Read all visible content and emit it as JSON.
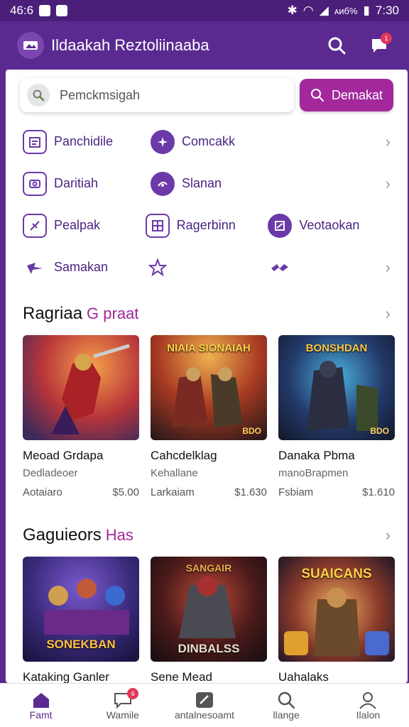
{
  "status": {
    "time_left": "46:6",
    "time_right": "7:30",
    "signal_text": "ᴀᴎб%"
  },
  "app": {
    "title": "Ildaakah Reztoliinaaba",
    "notif_count": "1"
  },
  "search": {
    "placeholder": "Pemckmsigah",
    "button_label": "Demakat"
  },
  "categories": {
    "row1": [
      "Panchidile",
      "Comcakk"
    ],
    "row2": [
      "Daritiah",
      "Slanan"
    ],
    "row3": [
      "Pealpak",
      "Ragerbinn",
      "Veotaokan"
    ],
    "row4": [
      "Samakan"
    ]
  },
  "section1": {
    "title": "Ragriaa",
    "accent": "G praat",
    "cards": [
      {
        "title": "Meoad Grdapa",
        "sub": "Dedladeoer",
        "meta_left": "Aotaiaro",
        "price": "$5.00",
        "banner": "",
        "badge": ""
      },
      {
        "title": "Cahcdelklag",
        "sub": "Kehallane",
        "meta_left": "Larkaiam",
        "price": "$1.630",
        "banner": "NIAIA SIONAIAH",
        "badge": "BDO"
      },
      {
        "title": "Danaka Pbma",
        "sub": "manoBrapmen",
        "meta_left": "Fsbiam",
        "price": "$1.610",
        "banner": "BONSHDAN",
        "badge": "BDO"
      }
    ]
  },
  "section2": {
    "title": "Gaguieors",
    "accent": "Has",
    "cards": [
      {
        "title": "Kataking Ganler",
        "banner": "SONEKBAN"
      },
      {
        "title": "Sene Mead",
        "banner": "SANGAIR",
        "banner2": "DINBALSS"
      },
      {
        "title": "Uahalaks",
        "banner": "SUAICANS"
      }
    ]
  },
  "nav": {
    "items": [
      "Famt",
      "Wamile",
      "antalnesoamt",
      "llange",
      "Ilalon"
    ],
    "badge": "6"
  },
  "colors": {
    "primary": "#5b2a91",
    "accent": "#a2289b",
    "badge": "#e0375a"
  }
}
